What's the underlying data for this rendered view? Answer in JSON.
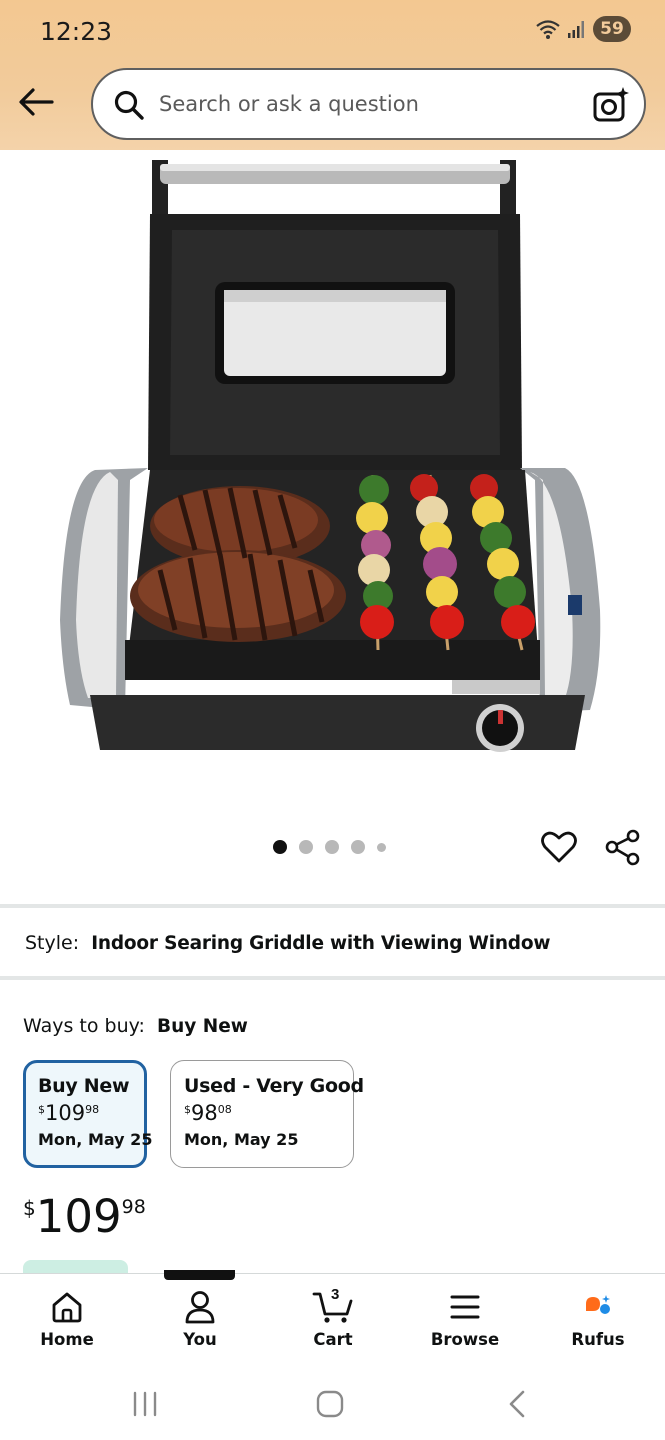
{
  "status_bar": {
    "time": "12:23",
    "battery": "59"
  },
  "search": {
    "placeholder": "Search or ask a question"
  },
  "gallery": {
    "image_count": 5,
    "active_index": 0
  },
  "style": {
    "label": "Style:",
    "value": "Indoor Searing Griddle with Viewing Window"
  },
  "ways_to_buy": {
    "label": "Ways to buy:",
    "selected": "Buy New",
    "options": [
      {
        "title": "Buy New",
        "currency": "$",
        "price_whole": "109",
        "price_fraction": "98",
        "delivery": "Mon, May 25"
      },
      {
        "title": "Used - Very Good",
        "currency": "$",
        "price_whole": "98",
        "price_fraction": "08",
        "delivery": "Mon, May 25"
      }
    ]
  },
  "price": {
    "currency": "$",
    "whole": "109",
    "fraction": "98"
  },
  "tabs": [
    {
      "label": "Home",
      "icon": "home-icon"
    },
    {
      "label": "You",
      "icon": "person-icon"
    },
    {
      "label": "Cart",
      "icon": "cart-icon",
      "count": "3"
    },
    {
      "label": "Browse",
      "icon": "menu-icon"
    },
    {
      "label": "Rufus",
      "icon": "rufus-icon"
    }
  ],
  "colors": {
    "header": "#f2cb9b",
    "selected_border": "#2162a1",
    "rufus_orange": "#ff6b1a",
    "rufus_blue": "#1f8ce6"
  }
}
